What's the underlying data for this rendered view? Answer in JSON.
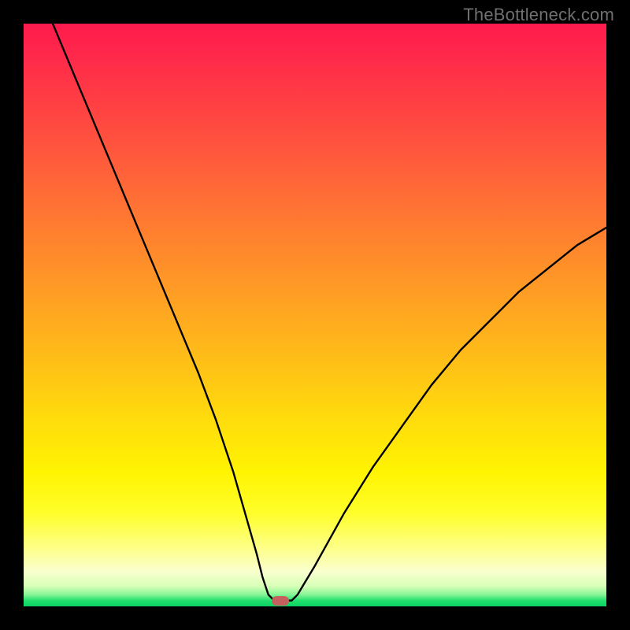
{
  "watermark": "TheBottleneck.com",
  "chart_data": {
    "type": "line",
    "title": "",
    "xlabel": "",
    "ylabel": "",
    "xlim": [
      0,
      100
    ],
    "ylim": [
      0,
      100
    ],
    "grid": false,
    "series": [
      {
        "name": "curve",
        "x": [
          5,
          10,
          15,
          20,
          25,
          30,
          33,
          36,
          38,
          40,
          41,
          42,
          43,
          44,
          45,
          46,
          47,
          50,
          55,
          60,
          65,
          70,
          75,
          80,
          85,
          90,
          95,
          100
        ],
        "y": [
          100,
          88,
          76,
          64,
          52,
          40,
          32,
          23,
          16,
          9,
          5,
          2,
          1,
          1,
          1,
          1,
          2,
          7,
          16,
          24,
          31,
          38,
          44,
          49,
          54,
          58,
          62,
          65
        ]
      }
    ],
    "marker": {
      "x": 44,
      "y": 1
    },
    "colors": {
      "curve": "#000000",
      "marker": "#c6605f",
      "gradient_top": "#ff1a4d",
      "gradient_mid": "#ffdc0c",
      "gradient_bottom": "#08d463"
    }
  }
}
